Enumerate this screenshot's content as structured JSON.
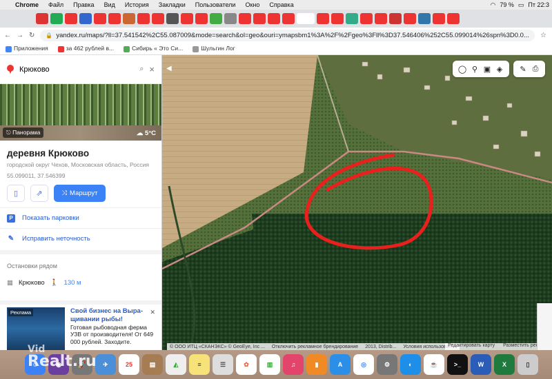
{
  "menubar": {
    "app": "Chrome",
    "items": [
      "Файл",
      "Правка",
      "Вид",
      "История",
      "Закладки",
      "Пользователи",
      "Окно",
      "Справка"
    ],
    "battery": "79 %",
    "clock": "Пт 22:3"
  },
  "browser": {
    "url": "yandex.ru/maps/?ll=37.541542%2C55.087009&mode=search&ol=geo&ouri=ymapsbm1%3A%2F%2Fgeo%3Fll%3D37.546406%252C55.099014%26spn%3D0.0...",
    "bookmarks": [
      "Приложения",
      "за 462 рублей в...",
      "Сибирь « Это Си...",
      "Шульгин Лог"
    ]
  },
  "panel": {
    "search_query": "Крюково",
    "panorama_label": "Панорама",
    "weather": "5°C",
    "title": "деревня Крюково",
    "subtitle": "городской округ Чехов, Московская область, Россия",
    "coords": "55.099011, 37.546399",
    "route_label": "Маршрут",
    "show_parking": "Показать парковки",
    "fix_inaccuracy": "Исправить неточность",
    "stops_header": "Остановки рядом",
    "stop_name": "Крюково",
    "stop_distance": "130 м",
    "ad_tag": "Реклама",
    "ad_title": "Свой бизнес на Выра- щивании рыбы!",
    "ad_text": "Готовая рыбоводная ферма УЗВ от производителя! От 649 000 рублей. Заходите."
  },
  "map": {
    "copyright": "© ООО ИТЦ «СКАНЭКС» © GeoEye, Inc ...",
    "disable_ads": "Отключить рекламное брендирование",
    "year": "2013, Distrib...",
    "terms": "Условия использования",
    "edit_map": "Редактировать карту",
    "place_business": "Разместить рекламу"
  },
  "watermark": {
    "line1": "Vid",
    "line2": "Realt.ru"
  },
  "colors": {
    "circle": "#e8201e",
    "route_button": "#3b82f6"
  }
}
